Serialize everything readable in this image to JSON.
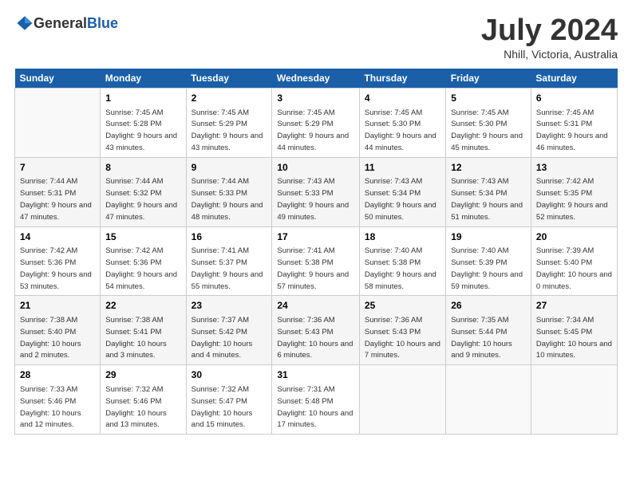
{
  "logo": {
    "general": "General",
    "blue": "Blue"
  },
  "title": "July 2024",
  "location": "Nhill, Victoria, Australia",
  "days_of_week": [
    "Sunday",
    "Monday",
    "Tuesday",
    "Wednesday",
    "Thursday",
    "Friday",
    "Saturday"
  ],
  "weeks": [
    [
      {
        "day": "",
        "sunrise": "",
        "sunset": "",
        "daylight": ""
      },
      {
        "day": "1",
        "sunrise": "Sunrise: 7:45 AM",
        "sunset": "Sunset: 5:28 PM",
        "daylight": "Daylight: 9 hours and 43 minutes."
      },
      {
        "day": "2",
        "sunrise": "Sunrise: 7:45 AM",
        "sunset": "Sunset: 5:29 PM",
        "daylight": "Daylight: 9 hours and 43 minutes."
      },
      {
        "day": "3",
        "sunrise": "Sunrise: 7:45 AM",
        "sunset": "Sunset: 5:29 PM",
        "daylight": "Daylight: 9 hours and 44 minutes."
      },
      {
        "day": "4",
        "sunrise": "Sunrise: 7:45 AM",
        "sunset": "Sunset: 5:30 PM",
        "daylight": "Daylight: 9 hours and 44 minutes."
      },
      {
        "day": "5",
        "sunrise": "Sunrise: 7:45 AM",
        "sunset": "Sunset: 5:30 PM",
        "daylight": "Daylight: 9 hours and 45 minutes."
      },
      {
        "day": "6",
        "sunrise": "Sunrise: 7:45 AM",
        "sunset": "Sunset: 5:31 PM",
        "daylight": "Daylight: 9 hours and 46 minutes."
      }
    ],
    [
      {
        "day": "7",
        "sunrise": "Sunrise: 7:44 AM",
        "sunset": "Sunset: 5:31 PM",
        "daylight": "Daylight: 9 hours and 47 minutes."
      },
      {
        "day": "8",
        "sunrise": "Sunrise: 7:44 AM",
        "sunset": "Sunset: 5:32 PM",
        "daylight": "Daylight: 9 hours and 47 minutes."
      },
      {
        "day": "9",
        "sunrise": "Sunrise: 7:44 AM",
        "sunset": "Sunset: 5:33 PM",
        "daylight": "Daylight: 9 hours and 48 minutes."
      },
      {
        "day": "10",
        "sunrise": "Sunrise: 7:43 AM",
        "sunset": "Sunset: 5:33 PM",
        "daylight": "Daylight: 9 hours and 49 minutes."
      },
      {
        "day": "11",
        "sunrise": "Sunrise: 7:43 AM",
        "sunset": "Sunset: 5:34 PM",
        "daylight": "Daylight: 9 hours and 50 minutes."
      },
      {
        "day": "12",
        "sunrise": "Sunrise: 7:43 AM",
        "sunset": "Sunset: 5:34 PM",
        "daylight": "Daylight: 9 hours and 51 minutes."
      },
      {
        "day": "13",
        "sunrise": "Sunrise: 7:42 AM",
        "sunset": "Sunset: 5:35 PM",
        "daylight": "Daylight: 9 hours and 52 minutes."
      }
    ],
    [
      {
        "day": "14",
        "sunrise": "Sunrise: 7:42 AM",
        "sunset": "Sunset: 5:36 PM",
        "daylight": "Daylight: 9 hours and 53 minutes."
      },
      {
        "day": "15",
        "sunrise": "Sunrise: 7:42 AM",
        "sunset": "Sunset: 5:36 PM",
        "daylight": "Daylight: 9 hours and 54 minutes."
      },
      {
        "day": "16",
        "sunrise": "Sunrise: 7:41 AM",
        "sunset": "Sunset: 5:37 PM",
        "daylight": "Daylight: 9 hours and 55 minutes."
      },
      {
        "day": "17",
        "sunrise": "Sunrise: 7:41 AM",
        "sunset": "Sunset: 5:38 PM",
        "daylight": "Daylight: 9 hours and 57 minutes."
      },
      {
        "day": "18",
        "sunrise": "Sunrise: 7:40 AM",
        "sunset": "Sunset: 5:38 PM",
        "daylight": "Daylight: 9 hours and 58 minutes."
      },
      {
        "day": "19",
        "sunrise": "Sunrise: 7:40 AM",
        "sunset": "Sunset: 5:39 PM",
        "daylight": "Daylight: 9 hours and 59 minutes."
      },
      {
        "day": "20",
        "sunrise": "Sunrise: 7:39 AM",
        "sunset": "Sunset: 5:40 PM",
        "daylight": "Daylight: 10 hours and 0 minutes."
      }
    ],
    [
      {
        "day": "21",
        "sunrise": "Sunrise: 7:38 AM",
        "sunset": "Sunset: 5:40 PM",
        "daylight": "Daylight: 10 hours and 2 minutes."
      },
      {
        "day": "22",
        "sunrise": "Sunrise: 7:38 AM",
        "sunset": "Sunset: 5:41 PM",
        "daylight": "Daylight: 10 hours and 3 minutes."
      },
      {
        "day": "23",
        "sunrise": "Sunrise: 7:37 AM",
        "sunset": "Sunset: 5:42 PM",
        "daylight": "Daylight: 10 hours and 4 minutes."
      },
      {
        "day": "24",
        "sunrise": "Sunrise: 7:36 AM",
        "sunset": "Sunset: 5:43 PM",
        "daylight": "Daylight: 10 hours and 6 minutes."
      },
      {
        "day": "25",
        "sunrise": "Sunrise: 7:36 AM",
        "sunset": "Sunset: 5:43 PM",
        "daylight": "Daylight: 10 hours and 7 minutes."
      },
      {
        "day": "26",
        "sunrise": "Sunrise: 7:35 AM",
        "sunset": "Sunset: 5:44 PM",
        "daylight": "Daylight: 10 hours and 9 minutes."
      },
      {
        "day": "27",
        "sunrise": "Sunrise: 7:34 AM",
        "sunset": "Sunset: 5:45 PM",
        "daylight": "Daylight: 10 hours and 10 minutes."
      }
    ],
    [
      {
        "day": "28",
        "sunrise": "Sunrise: 7:33 AM",
        "sunset": "Sunset: 5:46 PM",
        "daylight": "Daylight: 10 hours and 12 minutes."
      },
      {
        "day": "29",
        "sunrise": "Sunrise: 7:32 AM",
        "sunset": "Sunset: 5:46 PM",
        "daylight": "Daylight: 10 hours and 13 minutes."
      },
      {
        "day": "30",
        "sunrise": "Sunrise: 7:32 AM",
        "sunset": "Sunset: 5:47 PM",
        "daylight": "Daylight: 10 hours and 15 minutes."
      },
      {
        "day": "31",
        "sunrise": "Sunrise: 7:31 AM",
        "sunset": "Sunset: 5:48 PM",
        "daylight": "Daylight: 10 hours and 17 minutes."
      },
      {
        "day": "",
        "sunrise": "",
        "sunset": "",
        "daylight": ""
      },
      {
        "day": "",
        "sunrise": "",
        "sunset": "",
        "daylight": ""
      },
      {
        "day": "",
        "sunrise": "",
        "sunset": "",
        "daylight": ""
      }
    ]
  ]
}
